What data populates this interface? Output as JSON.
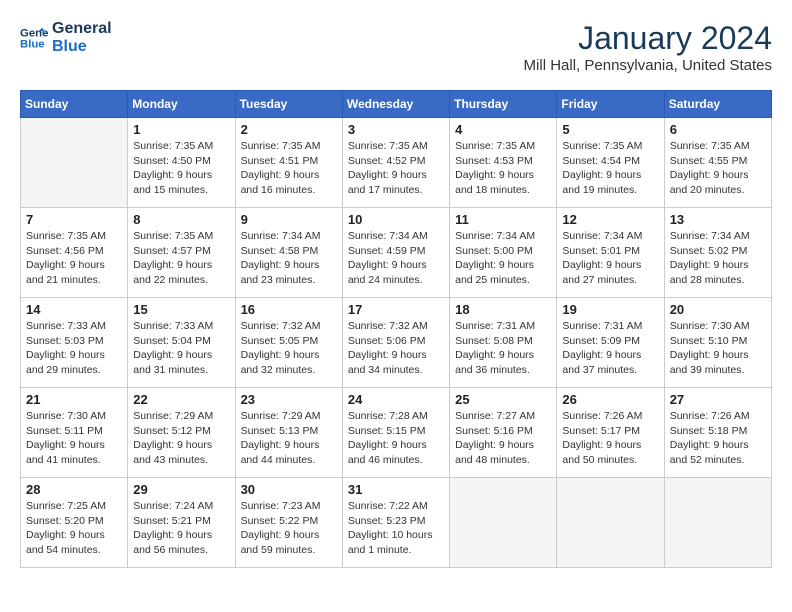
{
  "header": {
    "logo_line1": "General",
    "logo_line2": "Blue",
    "month_title": "January 2024",
    "location": "Mill Hall, Pennsylvania, United States"
  },
  "days_of_week": [
    "Sunday",
    "Monday",
    "Tuesday",
    "Wednesday",
    "Thursday",
    "Friday",
    "Saturday"
  ],
  "weeks": [
    [
      {
        "day": "",
        "info": ""
      },
      {
        "day": "1",
        "info": "Sunrise: 7:35 AM\nSunset: 4:50 PM\nDaylight: 9 hours\nand 15 minutes."
      },
      {
        "day": "2",
        "info": "Sunrise: 7:35 AM\nSunset: 4:51 PM\nDaylight: 9 hours\nand 16 minutes."
      },
      {
        "day": "3",
        "info": "Sunrise: 7:35 AM\nSunset: 4:52 PM\nDaylight: 9 hours\nand 17 minutes."
      },
      {
        "day": "4",
        "info": "Sunrise: 7:35 AM\nSunset: 4:53 PM\nDaylight: 9 hours\nand 18 minutes."
      },
      {
        "day": "5",
        "info": "Sunrise: 7:35 AM\nSunset: 4:54 PM\nDaylight: 9 hours\nand 19 minutes."
      },
      {
        "day": "6",
        "info": "Sunrise: 7:35 AM\nSunset: 4:55 PM\nDaylight: 9 hours\nand 20 minutes."
      }
    ],
    [
      {
        "day": "7",
        "info": "Sunrise: 7:35 AM\nSunset: 4:56 PM\nDaylight: 9 hours\nand 21 minutes."
      },
      {
        "day": "8",
        "info": "Sunrise: 7:35 AM\nSunset: 4:57 PM\nDaylight: 9 hours\nand 22 minutes."
      },
      {
        "day": "9",
        "info": "Sunrise: 7:34 AM\nSunset: 4:58 PM\nDaylight: 9 hours\nand 23 minutes."
      },
      {
        "day": "10",
        "info": "Sunrise: 7:34 AM\nSunset: 4:59 PM\nDaylight: 9 hours\nand 24 minutes."
      },
      {
        "day": "11",
        "info": "Sunrise: 7:34 AM\nSunset: 5:00 PM\nDaylight: 9 hours\nand 25 minutes."
      },
      {
        "day": "12",
        "info": "Sunrise: 7:34 AM\nSunset: 5:01 PM\nDaylight: 9 hours\nand 27 minutes."
      },
      {
        "day": "13",
        "info": "Sunrise: 7:34 AM\nSunset: 5:02 PM\nDaylight: 9 hours\nand 28 minutes."
      }
    ],
    [
      {
        "day": "14",
        "info": "Sunrise: 7:33 AM\nSunset: 5:03 PM\nDaylight: 9 hours\nand 29 minutes."
      },
      {
        "day": "15",
        "info": "Sunrise: 7:33 AM\nSunset: 5:04 PM\nDaylight: 9 hours\nand 31 minutes."
      },
      {
        "day": "16",
        "info": "Sunrise: 7:32 AM\nSunset: 5:05 PM\nDaylight: 9 hours\nand 32 minutes."
      },
      {
        "day": "17",
        "info": "Sunrise: 7:32 AM\nSunset: 5:06 PM\nDaylight: 9 hours\nand 34 minutes."
      },
      {
        "day": "18",
        "info": "Sunrise: 7:31 AM\nSunset: 5:08 PM\nDaylight: 9 hours\nand 36 minutes."
      },
      {
        "day": "19",
        "info": "Sunrise: 7:31 AM\nSunset: 5:09 PM\nDaylight: 9 hours\nand 37 minutes."
      },
      {
        "day": "20",
        "info": "Sunrise: 7:30 AM\nSunset: 5:10 PM\nDaylight: 9 hours\nand 39 minutes."
      }
    ],
    [
      {
        "day": "21",
        "info": "Sunrise: 7:30 AM\nSunset: 5:11 PM\nDaylight: 9 hours\nand 41 minutes."
      },
      {
        "day": "22",
        "info": "Sunrise: 7:29 AM\nSunset: 5:12 PM\nDaylight: 9 hours\nand 43 minutes."
      },
      {
        "day": "23",
        "info": "Sunrise: 7:29 AM\nSunset: 5:13 PM\nDaylight: 9 hours\nand 44 minutes."
      },
      {
        "day": "24",
        "info": "Sunrise: 7:28 AM\nSunset: 5:15 PM\nDaylight: 9 hours\nand 46 minutes."
      },
      {
        "day": "25",
        "info": "Sunrise: 7:27 AM\nSunset: 5:16 PM\nDaylight: 9 hours\nand 48 minutes."
      },
      {
        "day": "26",
        "info": "Sunrise: 7:26 AM\nSunset: 5:17 PM\nDaylight: 9 hours\nand 50 minutes."
      },
      {
        "day": "27",
        "info": "Sunrise: 7:26 AM\nSunset: 5:18 PM\nDaylight: 9 hours\nand 52 minutes."
      }
    ],
    [
      {
        "day": "28",
        "info": "Sunrise: 7:25 AM\nSunset: 5:20 PM\nDaylight: 9 hours\nand 54 minutes."
      },
      {
        "day": "29",
        "info": "Sunrise: 7:24 AM\nSunset: 5:21 PM\nDaylight: 9 hours\nand 56 minutes."
      },
      {
        "day": "30",
        "info": "Sunrise: 7:23 AM\nSunset: 5:22 PM\nDaylight: 9 hours\nand 59 minutes."
      },
      {
        "day": "31",
        "info": "Sunrise: 7:22 AM\nSunset: 5:23 PM\nDaylight: 10 hours\nand 1 minute."
      },
      {
        "day": "",
        "info": ""
      },
      {
        "day": "",
        "info": ""
      },
      {
        "day": "",
        "info": ""
      }
    ]
  ]
}
